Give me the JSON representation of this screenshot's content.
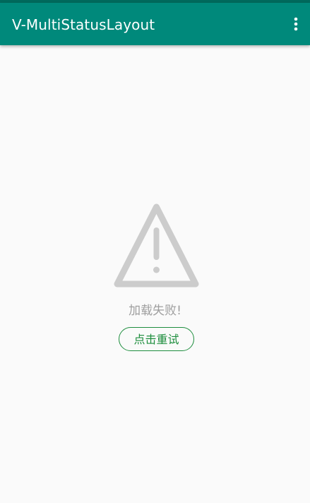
{
  "app_bar": {
    "title": "V-MultiStatusLayout",
    "background_color": "#00897b",
    "overflow_icon": "more-vert-icon"
  },
  "error_state": {
    "icon": "warning-triangle-icon",
    "icon_color": "#cccccc",
    "message": "加载失败!",
    "retry_label": "点击重试",
    "accent_color": "#1e8e3e"
  }
}
